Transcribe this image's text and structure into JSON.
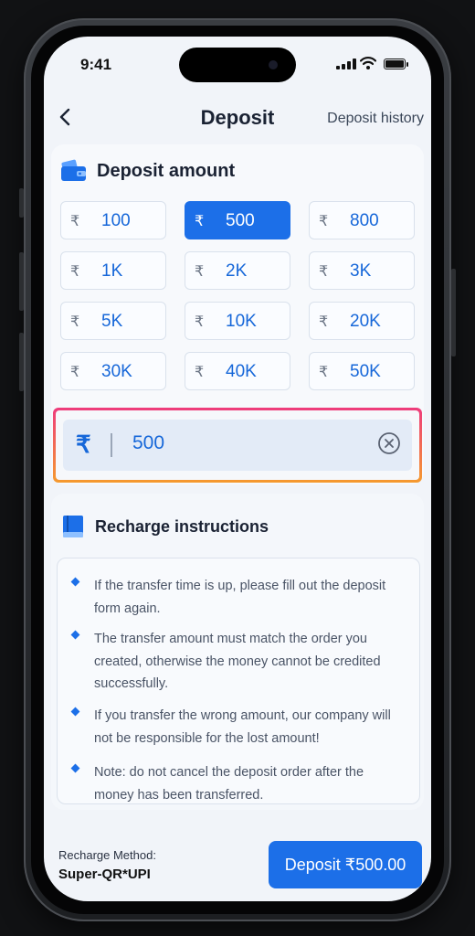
{
  "status_bar": {
    "time": "9:41"
  },
  "header": {
    "title": "Deposit",
    "history_link": "Deposit history"
  },
  "deposit_amount": {
    "title": "Deposit amount",
    "currency_symbol": "₹",
    "options": [
      "100",
      "500",
      "800",
      "1K",
      "2K",
      "3K",
      "5K",
      "10K",
      "20K",
      "30K",
      "40K",
      "50K"
    ],
    "selected": "500"
  },
  "amount_input": {
    "currency_symbol": "₹",
    "value": "500"
  },
  "instructions": {
    "title": "Recharge instructions",
    "items": [
      "If the transfer time is up, please fill out the deposit form again.",
      "The transfer amount must match the order you created, otherwise the money cannot be credited successfully.",
      "If you transfer the wrong amount, our company will not be responsible for the lost amount!",
      "Note: do not cancel the deposit order after the money has been transferred."
    ]
  },
  "footer": {
    "method_label": "Recharge Method:",
    "method_value": "Super-QR*UPI",
    "deposit_button": "Deposit ₹500.00"
  },
  "colors": {
    "accent": "#1c6fe8",
    "input_border_top": "#ee3b7c",
    "input_border_bottom": "#f59a2e"
  },
  "icons": [
    "back-arrow-icon",
    "wallet-icon",
    "book-icon",
    "clear-circle-x-icon",
    "signal-icon",
    "wifi-icon",
    "battery-icon"
  ]
}
